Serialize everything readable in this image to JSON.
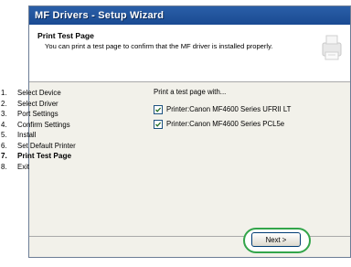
{
  "window": {
    "title": "MF Drivers - Setup Wizard"
  },
  "header": {
    "title": "Print Test Page",
    "description": "You can print a test page to confirm that the MF driver is installed properly."
  },
  "steps": [
    {
      "num": "1.",
      "label": "Select Device"
    },
    {
      "num": "2.",
      "label": "Select Driver"
    },
    {
      "num": "3.",
      "label": "Port Settings"
    },
    {
      "num": "4.",
      "label": "Confirm Settings"
    },
    {
      "num": "5.",
      "label": "Install"
    },
    {
      "num": "6.",
      "label": "Set Default Printer"
    },
    {
      "num": "7.",
      "label": "Print Test Page",
      "current": true
    },
    {
      "num": "8.",
      "label": "Exit"
    }
  ],
  "content": {
    "label": "Print a test page with...",
    "options": [
      {
        "label": "Printer:Canon MF4600 Series UFRII LT",
        "checked": true
      },
      {
        "label": "Printer:Canon MF4600 Series PCL5e",
        "checked": true
      }
    ]
  },
  "footer": {
    "next_label": "Next >"
  },
  "colors": {
    "titlebar": "#1a4a92",
    "panel": "#f2f1ea",
    "highlight_ring": "#33a54a"
  }
}
